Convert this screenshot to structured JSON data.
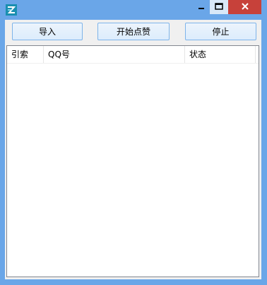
{
  "window": {
    "icon": "app-icon",
    "controls": {
      "minimize_icon": "minimize-icon",
      "maximize_icon": "maximize-icon",
      "close_icon": "close-icon"
    }
  },
  "toolbar": {
    "import_label": "导入",
    "start_like_label": "开始点赞",
    "stop_label": "停止"
  },
  "list": {
    "columns": [
      "引索",
      "QQ号",
      "状态"
    ],
    "rows": []
  },
  "colors": {
    "frame": "#6aa6e8",
    "close_button": "#c7413a",
    "button_border": "#7eb4ea"
  }
}
